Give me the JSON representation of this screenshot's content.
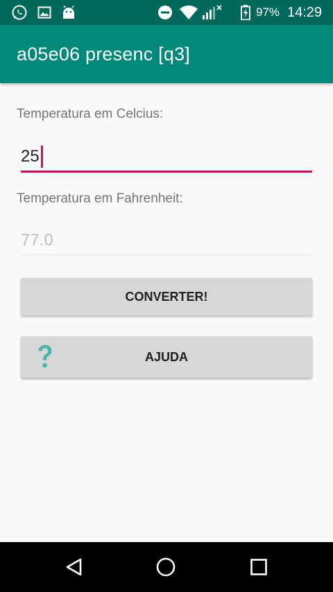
{
  "status_bar": {
    "icons_left": [
      "whatsapp-icon",
      "image-icon",
      "android-icon"
    ],
    "icons_right": [
      "do-not-disturb-icon",
      "wifi-icon",
      "signal-icon",
      "battery-icon"
    ],
    "battery": "97%",
    "time": "14:29",
    "background": "#00695c"
  },
  "app_bar": {
    "title": "a05e06 presenc [q3]",
    "background": "#00897b"
  },
  "form": {
    "celsius_label": "Temperatura em Celcius:",
    "celsius_value": "25",
    "fahrenheit_label": "Temperatura em Fahrenheit:",
    "fahrenheit_value": "77.0",
    "accent": "#c2185b"
  },
  "buttons": {
    "convert_label": "CONVERTER!",
    "help_label": "AJUDA",
    "help_icon": "question-mark-icon",
    "help_icon_color": "#4db6ac"
  },
  "nav_bar": {
    "back": "back-icon",
    "home": "home-icon",
    "recents": "recents-icon"
  }
}
